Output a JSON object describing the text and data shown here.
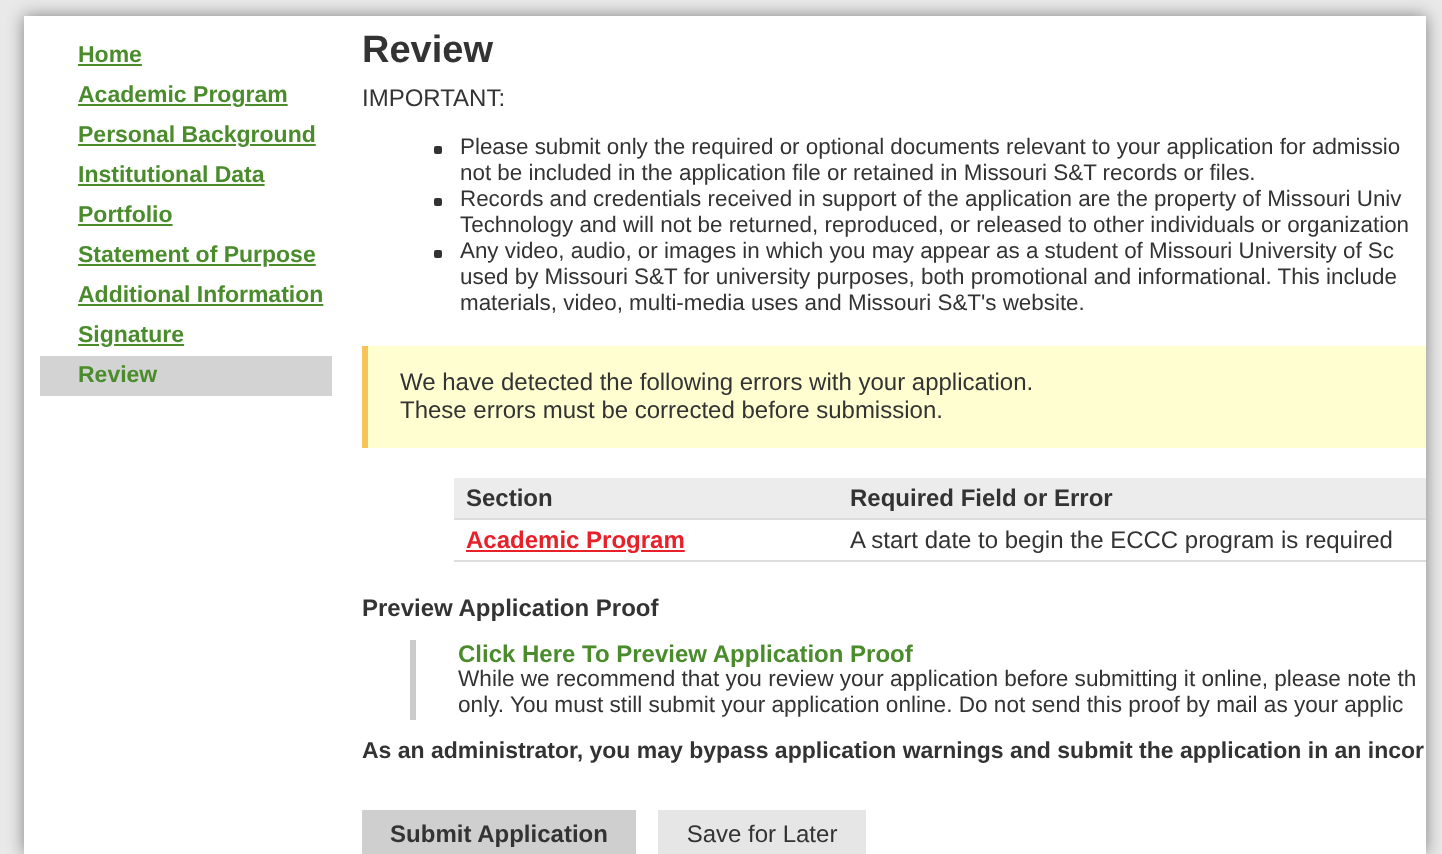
{
  "sidebar": {
    "items": [
      {
        "label": "Home",
        "selected": false
      },
      {
        "label": "Academic Program",
        "selected": false
      },
      {
        "label": "Personal Background",
        "selected": false
      },
      {
        "label": "Institutional Data",
        "selected": false
      },
      {
        "label": "Portfolio",
        "selected": false
      },
      {
        "label": "Statement of Purpose",
        "selected": false
      },
      {
        "label": "Additional Information",
        "selected": false
      },
      {
        "label": "Signature",
        "selected": false
      },
      {
        "label": "Review",
        "selected": true
      }
    ]
  },
  "title": "Review",
  "important_label": "IMPORTANT:",
  "bullets": [
    {
      "lines": [
        "Please submit only the required or optional documents relevant to your application for admissio",
        "not be included in the application file or retained in Missouri S&T records or files."
      ]
    },
    {
      "lines": [
        "Records and credentials received in support of the application are the property of Missouri Univ",
        "Technology and will not be returned, reproduced, or released to other individuals or organization"
      ]
    },
    {
      "lines": [
        "Any video, audio, or images in which you may appear as a student of Missouri University of Sc",
        "used by Missouri S&T for university purposes, both promotional and informational. This include",
        "materials, video, multi-media uses and Missouri S&T's website."
      ]
    }
  ],
  "alert": {
    "lines": [
      "We have detected the following errors with your application.",
      "These errors must be corrected before submission."
    ]
  },
  "errors_table": {
    "columns": [
      "Section",
      "Required Field or Error"
    ],
    "rows": [
      {
        "section": "Academic Program",
        "error": "A start date to begin the ECCC program is required"
      }
    ]
  },
  "preview": {
    "heading": "Preview Application Proof",
    "link": "Click Here To Preview Application Proof",
    "lines": [
      "While we recommend that you review your application before submitting it online, please note th",
      "only. You must still submit your application online. Do not send this proof by mail as your applic"
    ]
  },
  "admin_note": "As an administrator, you may bypass application warnings and submit the application in an incor",
  "buttons": [
    {
      "label": "Submit Application",
      "kind": "primary"
    },
    {
      "label": "Save for Later",
      "kind": "secondary"
    }
  ]
}
